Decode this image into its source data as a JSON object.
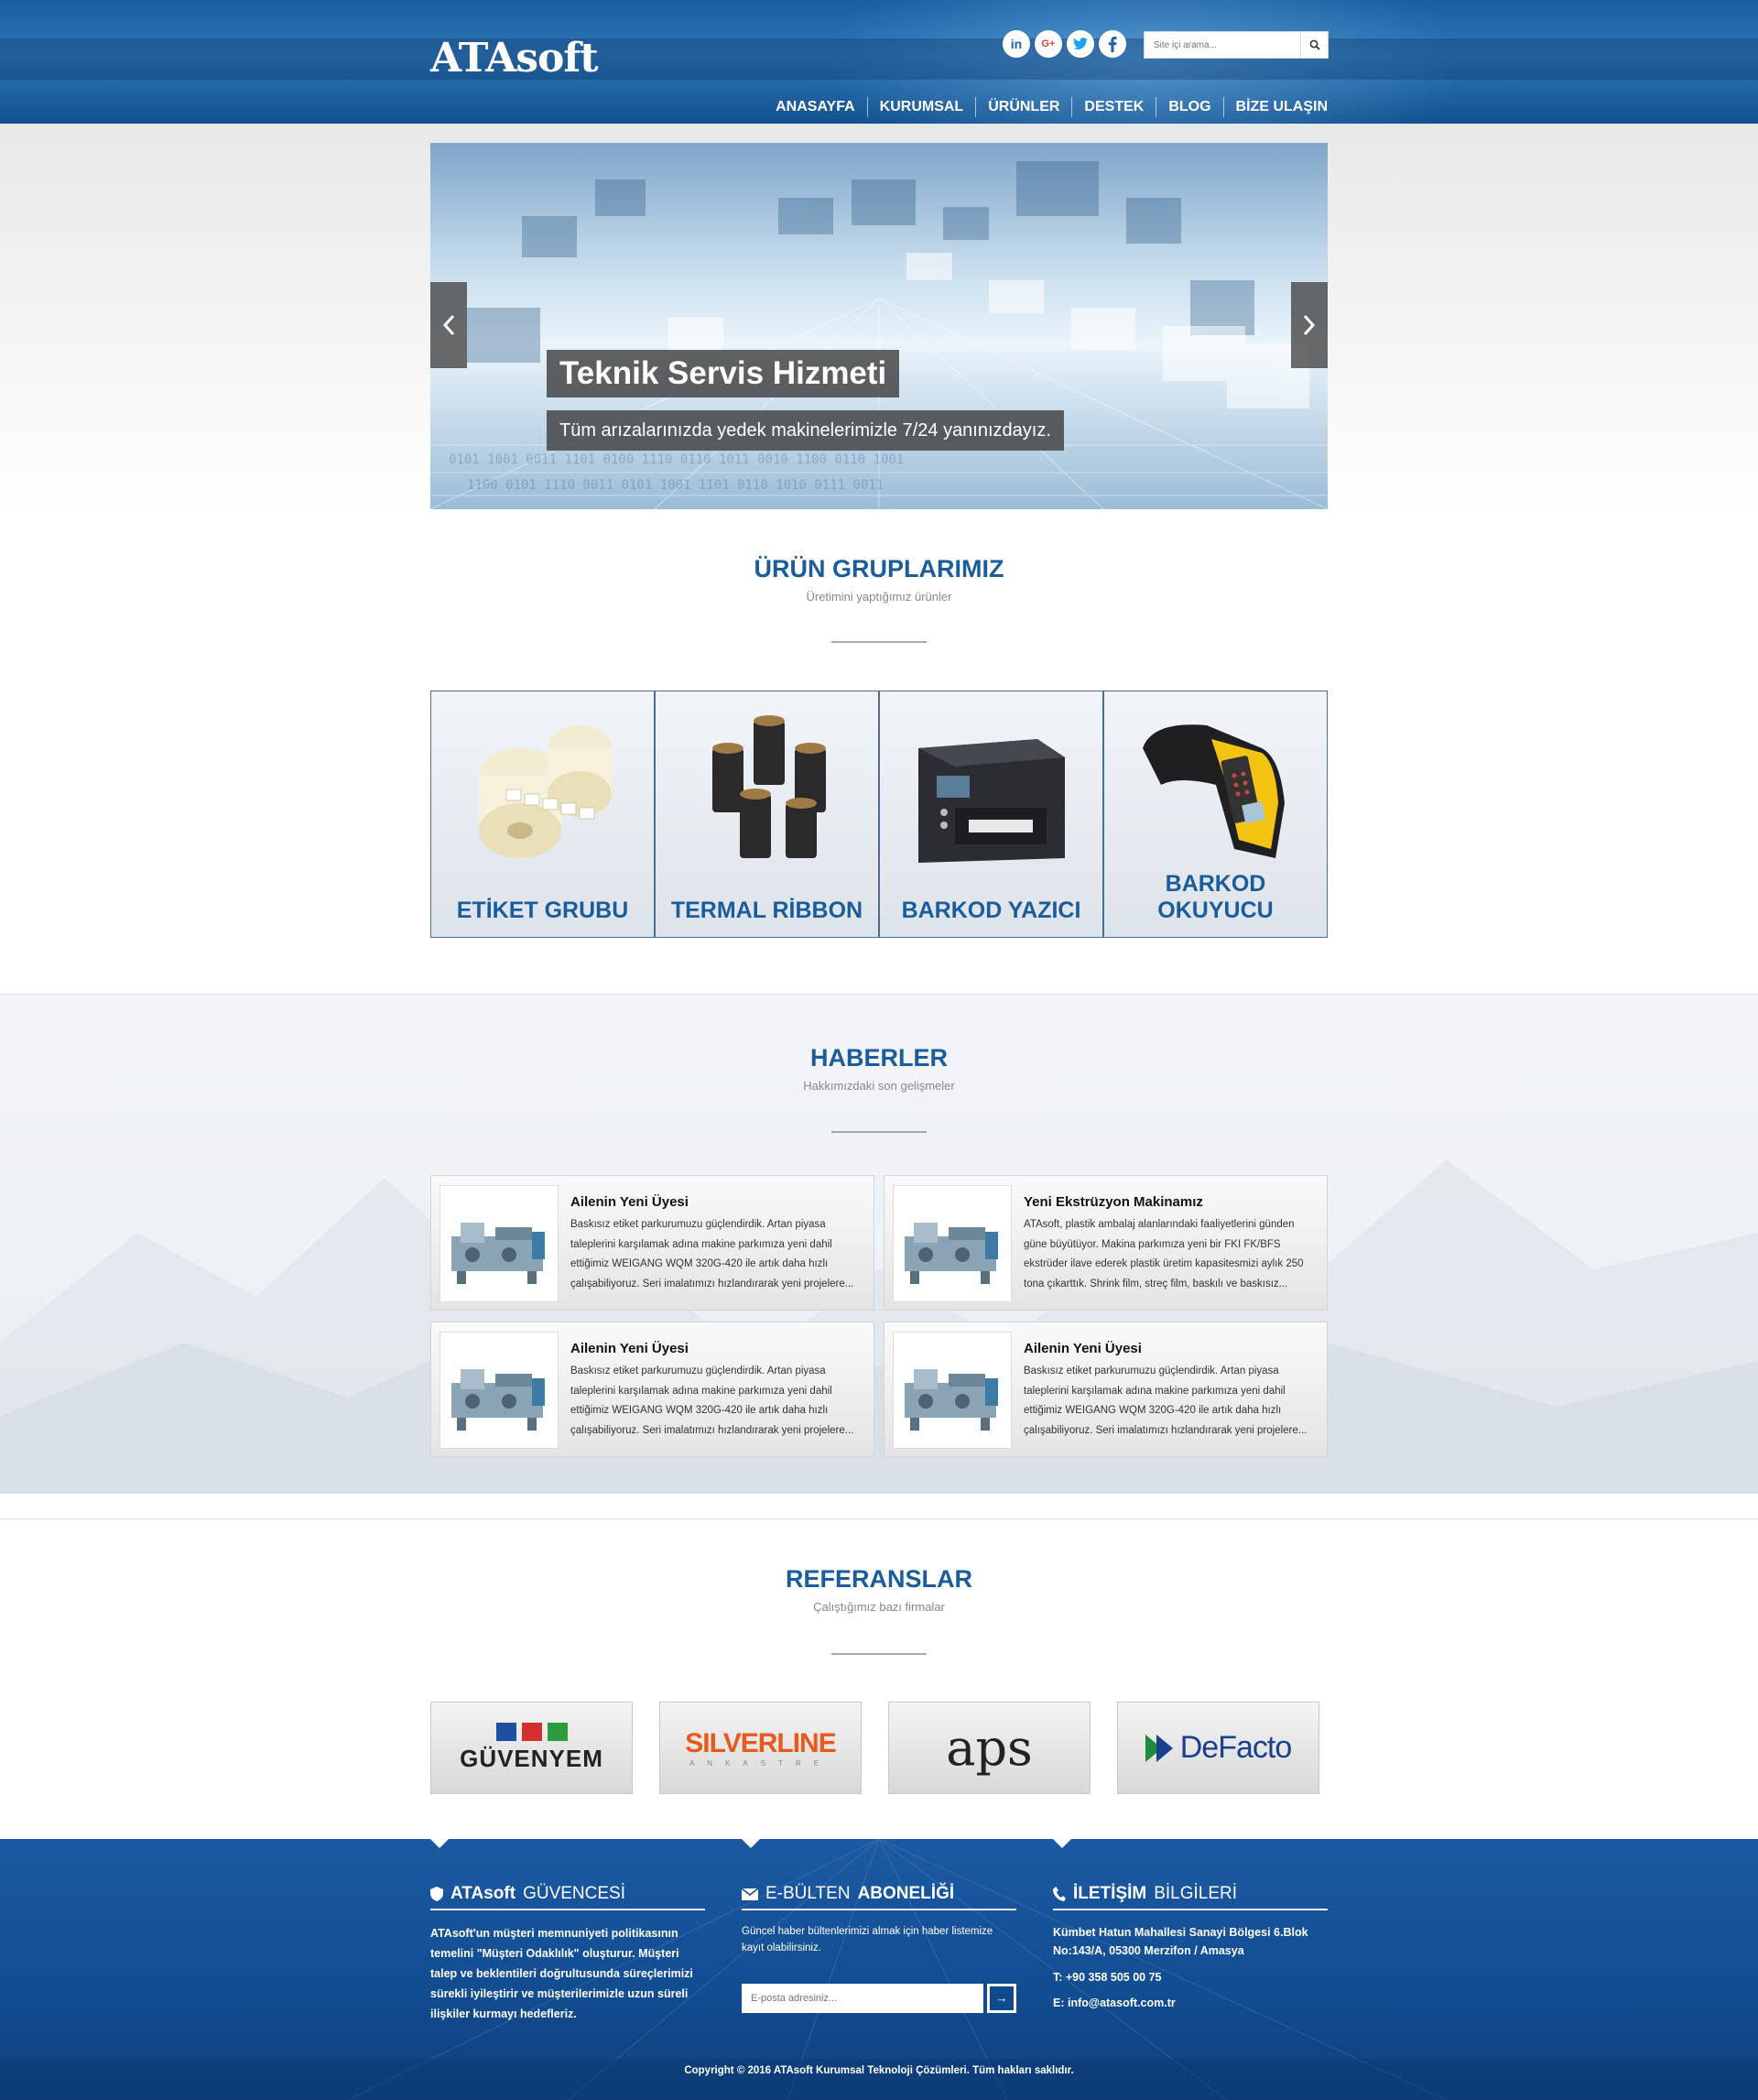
{
  "header": {
    "logo": "ATAsoft",
    "social": [
      {
        "icon": "linkedin-icon",
        "label": "in"
      },
      {
        "icon": "googleplus-icon",
        "label": "G+"
      },
      {
        "icon": "twitter-icon",
        "label": "t"
      },
      {
        "icon": "facebook-icon",
        "label": "f"
      }
    ],
    "search": {
      "placeholder": "Site içi arama..."
    },
    "nav": [
      "ANASAYFA",
      "KURUMSAL",
      "ÜRÜNLER",
      "DESTEK",
      "BLOG",
      "BİZE ULAŞIN"
    ]
  },
  "slider": {
    "title": "Teknik Servis Hizmeti",
    "subtitle": "Tüm arızalarınızda yedek makinelerimizle 7/24 yanınızdayız."
  },
  "products": {
    "title": "ÜRÜN GRUPLARIMIZ",
    "subtitle": "Üretimini yaptığımız ürünler",
    "items": [
      "ETİKET GRUBU",
      "TERMAL RİBBON",
      "BARKOD YAZICI",
      "BARKOD OKUYUCU"
    ]
  },
  "news": {
    "title": "HABERLER",
    "subtitle": "Hakkımızdaki son gelişmeler",
    "items": [
      {
        "title": "Ailenin Yeni Üyesi",
        "text": "Baskısız etiket parkurumuzu güçlendirdik. Artan piyasa taleplerini karşılamak adına makine parkımıza yeni dahil ettiğimiz WEIGANG WQM 320G-420 ile artık daha hızlı çalışabiliyoruz. Seri imalatımızı hızlandırarak yeni projelere..."
      },
      {
        "title": "Yeni Ekstrüzyon Makinamız",
        "text": "ATAsoft, plastik ambalaj alanlarındaki faaliyetlerini günden güne büyütüyor. Makina parkımıza yeni bir FKI FK/BFS ekstrüder ilave ederek plastik üretim kapasitesmizi aylık 250 tona çıkarttık. Shrink film, streç film, baskılı ve baskısız..."
      },
      {
        "title": "Ailenin Yeni Üyesi",
        "text": "Baskısız etiket parkurumuzu güçlendirdik. Artan piyasa taleplerini karşılamak adına makine parkımıza yeni dahil ettiğimiz WEIGANG WQM 320G-420 ile artık daha hızlı çalışabiliyoruz. Seri imalatımızı hızlandırarak yeni projelere..."
      },
      {
        "title": "Ailenin Yeni Üyesi",
        "text": "Baskısız etiket parkurumuzu güçlendirdik. Artan piyasa taleplerini karşılamak adına makine parkımıza yeni dahil ettiğimiz WEIGANG WQM 320G-420 ile artık daha hızlı çalışabiliyoruz. Seri imalatımızı hızlandırarak yeni projelere..."
      }
    ]
  },
  "references": {
    "title": "REFERANSLAR",
    "subtitle": "Çalıştığımız bazı firmalar",
    "logos": [
      {
        "name": "GÜVENYEM"
      },
      {
        "name": "SILVERLINE",
        "tagline": "ANKASTRE"
      },
      {
        "name": "aps"
      },
      {
        "name": "DeFacto"
      }
    ]
  },
  "footer": {
    "guarantee": {
      "title_bold": "ATAsoft",
      "title_rest": "GÜVENCESİ",
      "text": "ATAsoft'un müşteri memnuniyeti politikasının temelini \"Müşteri Odaklılık\" oluşturur. Müşteri talep ve beklentileri doğrultusunda süreçlerimizi sürekli iyileştirir ve müşterilerimizle uzun süreli ilişkiler kurmayı hedefleriz."
    },
    "newsletter": {
      "title_thin": "E-BÜLTEN",
      "title_bold": "ABONELİĞİ",
      "text": "Güncel haber bültenlerimizi almak için haber listemize kayıt olabilirsiniz.",
      "placeholder": "E-posta adresiniz..."
    },
    "contact": {
      "title_bold": "İLETİŞİM",
      "title_thin": "BİLGİLERİ",
      "address": "Kümbet Hatun Mahallesi Sanayi Bölgesi 6.Blok No:143/A, 05300 Merzifon / Amasya",
      "phone": "T: +90 358 505 00 75",
      "email": "E: info@atasoft.com.tr"
    },
    "copyright": "Copyright © 2016 ATAsoft Kurumsal Teknoloji Çözümleri. Tüm hakları saklıdır."
  },
  "colors": {
    "brand_blue": "#1b5c9b",
    "header_blue": "#2f78b8",
    "footer_blue": "#124c91"
  }
}
